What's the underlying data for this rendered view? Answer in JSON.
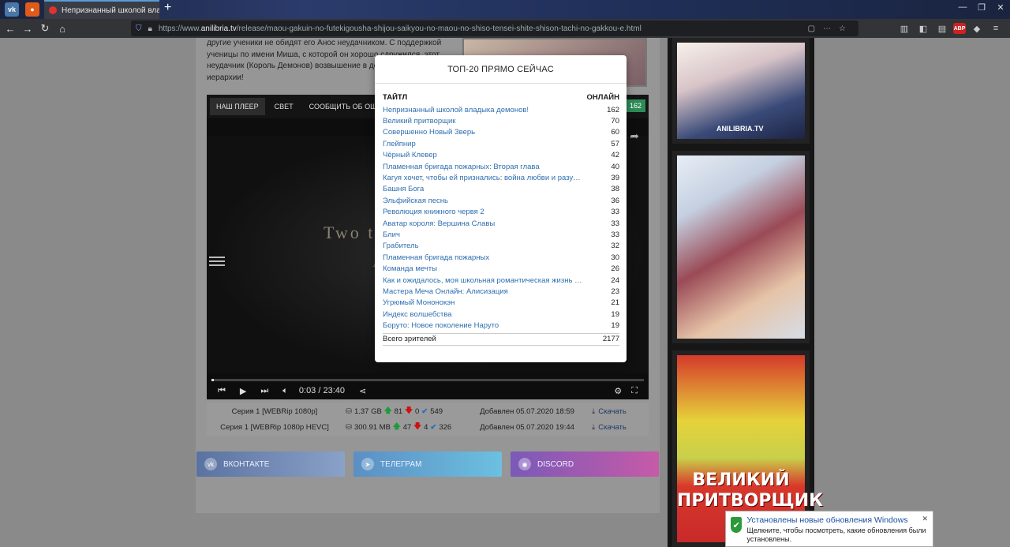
{
  "browser": {
    "tab_title": "Непризнанный школой владыка",
    "url_prefix": "https://www.",
    "url_host": "anilibria.tv",
    "url_path": "/release/maou-gakuin-no-futekigousha-shijou-saikyou-no-maou-no-shiso-tensei-shite-shison-tachi-no-gakkou-e.html",
    "abp_label": "ABP"
  },
  "page": {
    "description": "другие ученики не обидят его Анос неудачником. С поддержкой ученицы по имени Миша, с которой он хорошо сдружился, этот неудачник (Король Демонов) возвышение в демонической иерархии!",
    "player": {
      "tabs": [
        "НАШ ПЛЕЕР",
        "СВЕТ",
        "СООБЩИТЬ ОБ ОШИБКЕ"
      ],
      "badge": "162",
      "video_text": "Two t",
      "video_text2": "A",
      "time": "0:03 / 23:40",
      "progress": 0.002
    },
    "downloads": [
      {
        "episode": "Серия 1 [WEBRip 1080p]",
        "size": "1.37 GB",
        "seeders": "81",
        "leechers": "0",
        "completed": "549",
        "added": "Добавлен 05.07.2020 18:59",
        "link": "Скачать"
      },
      {
        "episode": "Серия 1 [WEBRip 1080p HEVC]",
        "size": "300.91 MB",
        "seeders": "47",
        "leechers": "4",
        "completed": "326",
        "added": "Добавлен 05.07.2020 19:44",
        "link": "Скачать"
      }
    ],
    "social": {
      "vk": "ВКОНТАКТЕ",
      "telegram": "ТЕЛЕГРАМ",
      "discord": "DISCORD"
    },
    "sidebar": {
      "watermark": "ANILIBRIA.TV",
      "poster3_title": "ВЕЛИКИЙ ПРИТВОРЩИК"
    }
  },
  "modal": {
    "title": "ТОП-20 ПРЯМО СЕЙЧАС",
    "col_title": "ТАЙТЛ",
    "col_online": "ОНЛАЙН",
    "rows": [
      {
        "title": "Непризнанный школой владыка демонов!",
        "online": "162"
      },
      {
        "title": "Великий притворщик",
        "online": "70"
      },
      {
        "title": "Совершенно Новый Зверь",
        "online": "60"
      },
      {
        "title": "Глейпнир",
        "online": "57"
      },
      {
        "title": "Чёрный Клевер",
        "online": "42"
      },
      {
        "title": "Пламенная бригада пожарных: Вторая глава",
        "online": "40"
      },
      {
        "title": "Кагуя хочет, чтобы ей признались: война любви и разума…",
        "online": "39"
      },
      {
        "title": "Башня Бога",
        "online": "38"
      },
      {
        "title": "Эльфийская песнь",
        "online": "36"
      },
      {
        "title": "Революция книжного червя 2",
        "online": "33"
      },
      {
        "title": "Аватар короля: Вершина Славы",
        "online": "33"
      },
      {
        "title": "Блич",
        "online": "33"
      },
      {
        "title": "Грабитель",
        "online": "32"
      },
      {
        "title": "Пламенная бригада пожарных",
        "online": "30"
      },
      {
        "title": "Команда мечты",
        "online": "26"
      },
      {
        "title": "Как и ожидалось, моя школьная романтическая жизнь не…",
        "online": "24"
      },
      {
        "title": "Мастера Меча Онлайн: Алисизация",
        "online": "23"
      },
      {
        "title": "Угрюмый Мононокэн",
        "online": "21"
      },
      {
        "title": "Индекс волшебства",
        "online": "19"
      },
      {
        "title": "Боруто: Новое поколение Наруто",
        "online": "19"
      }
    ],
    "total_label": "Всего зрителей",
    "total_value": "2177"
  },
  "toast": {
    "title": "Установлены новые обновления Windows",
    "body": "Щелкните, чтобы посмотреть, какие обновления были установлены."
  }
}
